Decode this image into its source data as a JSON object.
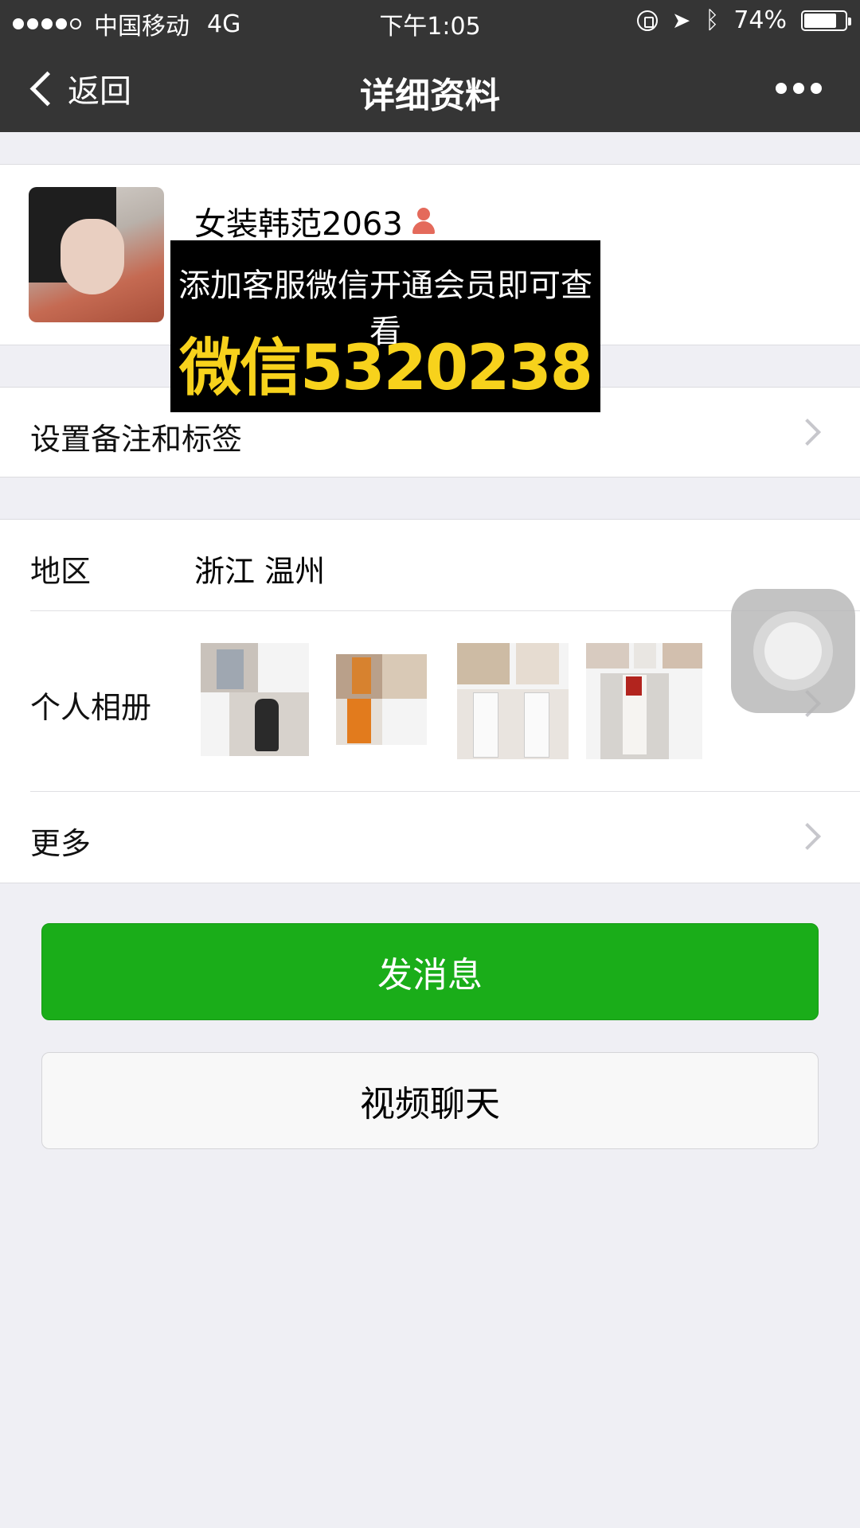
{
  "status_bar": {
    "carrier": "中国移动",
    "network": "4G",
    "time": "下午1:05",
    "battery": "74%"
  },
  "nav": {
    "back_label": "返回",
    "title": "详细资料"
  },
  "profile": {
    "name": "女装韩范2063",
    "gender_icon": "female-icon"
  },
  "ad_overlay": {
    "line1": "添加客服微信开通会员即可查看",
    "line2": "微信5320238",
    "colors": {
      "background": "#000000",
      "line1": "#ffffff",
      "line2": "#f7d21c"
    }
  },
  "rows": {
    "remark_label": "设置备注和标签",
    "region_label": "地区",
    "region_value": "浙江 温州",
    "album_label": "个人相册",
    "more_label": "更多"
  },
  "buttons": {
    "send_message": "发消息",
    "video_chat": "视频聊天"
  },
  "colors": {
    "nav_bg": "#353535",
    "page_bg": "#efeff4",
    "primary_green": "#1aad19"
  }
}
